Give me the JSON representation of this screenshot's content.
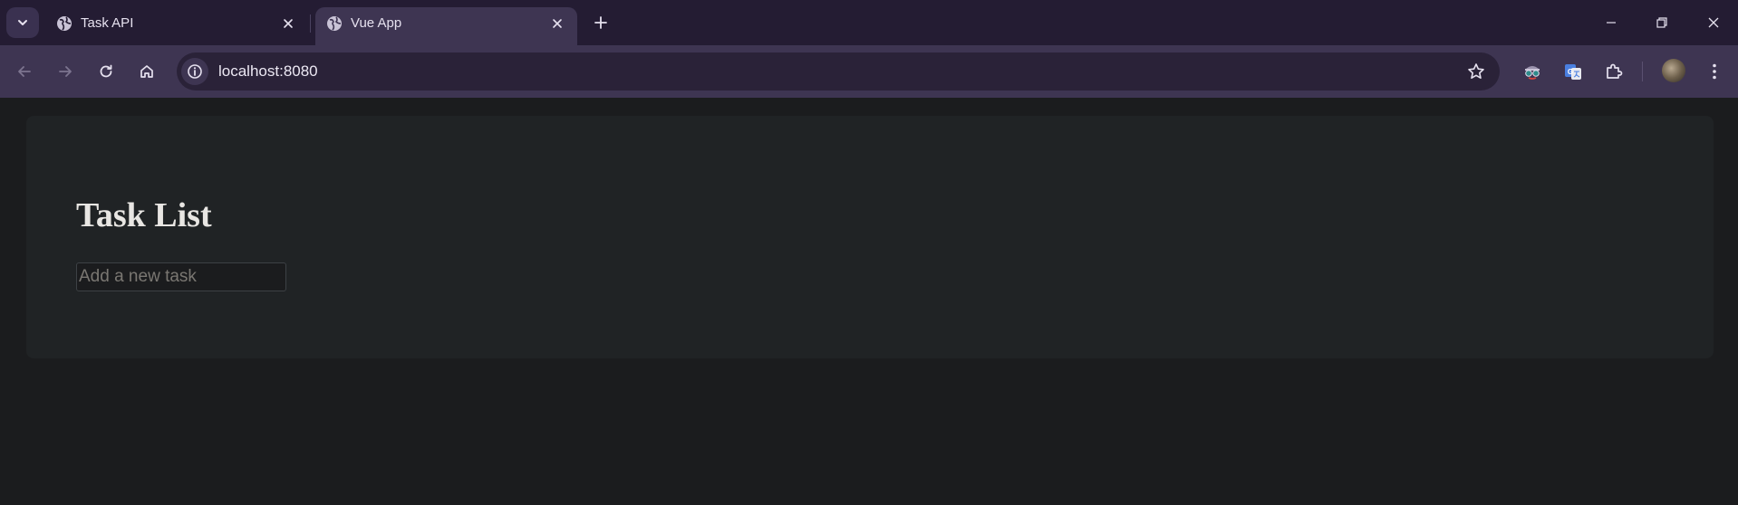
{
  "browser": {
    "tabs": [
      {
        "title": "Task API",
        "favicon": "globe-icon",
        "active": false
      },
      {
        "title": "Vue App",
        "favicon": "globe-icon",
        "active": true
      }
    ],
    "address": "localhost:8080",
    "colors": {
      "tabstrip": "#241c33",
      "toolbar": "#3e3552",
      "omnibox": "#2a2238"
    }
  },
  "page": {
    "heading": "Task List",
    "new_task_input": {
      "value": "",
      "placeholder": "Add a new task"
    },
    "colors": {
      "background": "#1b1c1e",
      "card": "#202325",
      "text": "#e8e6e3"
    }
  }
}
